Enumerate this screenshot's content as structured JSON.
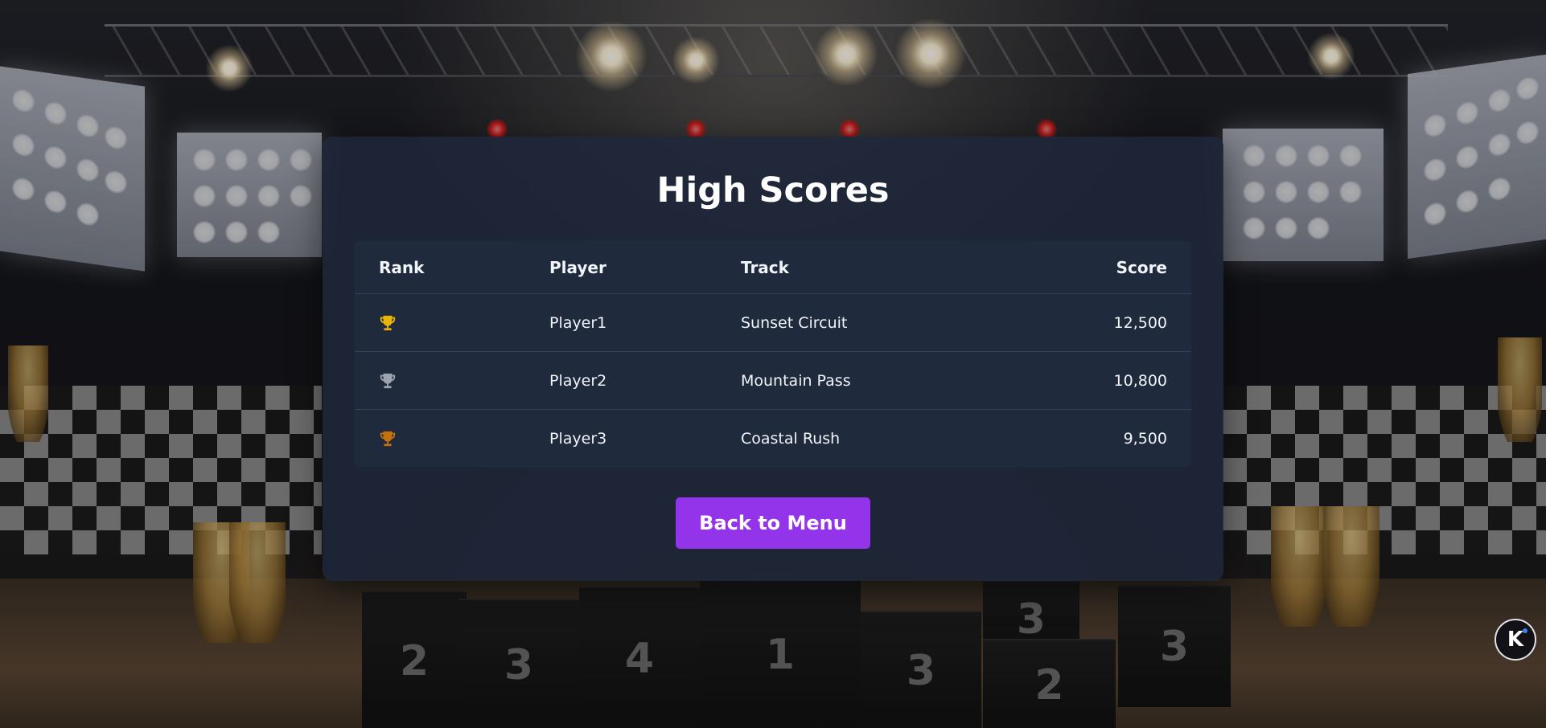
{
  "screen": {
    "title": "High Scores",
    "columns": {
      "rank": "Rank",
      "player": "Player",
      "track": "Track",
      "score": "Score"
    },
    "rows": [
      {
        "rank_icon": "gold-trophy-icon",
        "rank_color": "#eab308",
        "player": "Player1",
        "track": "Sunset Circuit",
        "score": "12,500"
      },
      {
        "rank_icon": "silver-trophy-icon",
        "rank_color": "#9ca3af",
        "player": "Player2",
        "track": "Mountain Pass",
        "score": "10,800"
      },
      {
        "rank_icon": "bronze-trophy-icon",
        "rank_color": "#c2710c",
        "player": "Player3",
        "track": "Coastal Rush",
        "score": "9,500"
      }
    ],
    "back_button": "Back to Menu"
  },
  "background": {
    "podium_numbers": [
      "2",
      "3",
      "4",
      "1",
      "3",
      "3",
      "2",
      "3"
    ]
  },
  "badge": {
    "label": "K",
    "icon": "brand-logo-icon"
  },
  "colors": {
    "accent": "#9333ea",
    "card": "#1e273a",
    "table": "#1f2a3d",
    "text": "#ffffff"
  }
}
